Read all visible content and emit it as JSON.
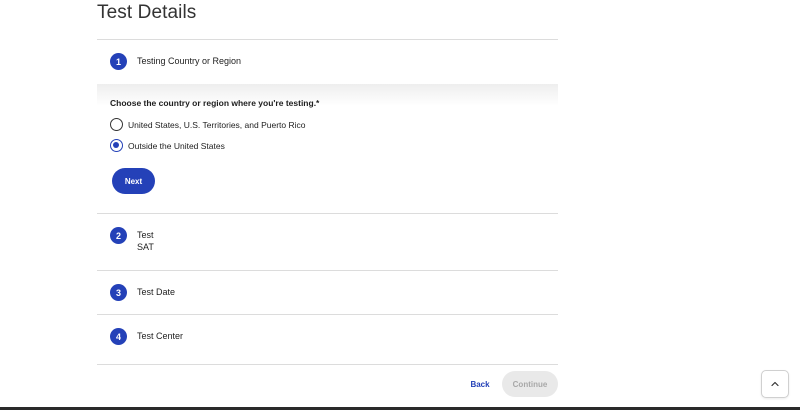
{
  "page": {
    "title": "Test Details"
  },
  "steps": [
    {
      "number": "1",
      "title": "Testing Country or Region"
    },
    {
      "number": "2",
      "title": "Test",
      "value": "SAT"
    },
    {
      "number": "3",
      "title": "Test Date"
    },
    {
      "number": "4",
      "title": "Test Center"
    }
  ],
  "step1": {
    "question": "Choose the country or region where you're testing.*",
    "options": [
      {
        "label": "United States, U.S. Territories, and Puerto Rico",
        "checked": false
      },
      {
        "label": "Outside the United States",
        "checked": true
      }
    ],
    "next_label": "Next"
  },
  "footer": {
    "back_label": "Back",
    "continue_label": "Continue"
  },
  "colors": {
    "accent": "#2441b8",
    "disabled_bg": "#e9e9e9",
    "divider": "#dcdcdc"
  },
  "icons": {
    "scroll_top": "chevron-up-icon"
  }
}
